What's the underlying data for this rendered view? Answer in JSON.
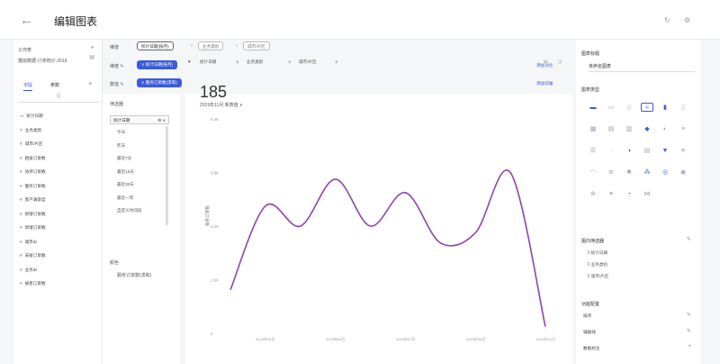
{
  "header": {
    "back_glyph": "←",
    "title": "编辑图表"
  },
  "left": {
    "worksheet_label": "工作表",
    "worksheet_name": "模拟数据-订单统计-2019",
    "tabs": [
      "字段",
      "参数"
    ],
    "search_glyph": "Q",
    "fields": [
      {
        "icon": "▭",
        "label": "统计日期"
      },
      {
        "icon": "T",
        "label": "业务类别"
      },
      {
        "icon": "T",
        "label": "城市/片区"
      },
      {
        "icon": "#",
        "label": "租投订单数"
      },
      {
        "icon": "#",
        "label": "协评订单数"
      },
      {
        "icon": "#",
        "label": "服务订单数"
      },
      {
        "icon": "#",
        "label": "客户满意度"
      },
      {
        "icon": "#",
        "label": "新增订单数"
      },
      {
        "icon": "#",
        "label": "新增订单数"
      },
      {
        "icon": "#",
        "label": "城市ID"
      },
      {
        "icon": "#",
        "label": "未接订单数"
      },
      {
        "icon": "#",
        "label": "业务ID"
      },
      {
        "icon": "#",
        "label": "被拒订单数"
      }
    ]
  },
  "toolbar": {
    "dimension_label": "维度",
    "dim_pills": [
      "统计日期(按月)",
      "业务类别",
      "城市/片区"
    ],
    "trend_label": "维度 ✎",
    "trend_pill": "∨ 统计日期(按月)",
    "add_compare": "添加对比",
    "value_label": "数值 ✎",
    "value_pill": "∨ 服务订单数(求和)",
    "add_axis": "添加双轴"
  },
  "filter": {
    "title": "筛选器",
    "dropdown": "统计日期",
    "options": [
      "今天",
      "昨天",
      "最近7天",
      "最近15天",
      "最近30天",
      "最近一年",
      "自定义时间段"
    ],
    "color_label": "颜色",
    "color_value": "服务订单数(求和)"
  },
  "chart_filters": [
    "统计日期",
    "业务类别",
    "城市/片区"
  ],
  "kpi": {
    "value": "185",
    "sub": "2019年11月 新数值 ∨"
  },
  "chart_data": {
    "type": "line",
    "x": [
      "2019年3月",
      "2019年4月",
      "2019年5月",
      "2019年6月",
      "2019年7月",
      "2019年8月",
      "2019年9月",
      "2019年10月",
      "2019年11月"
    ],
    "x_tick_labels": [
      "2019年05月",
      "2019年06月",
      "2019年07月",
      "2019年08月",
      "2019年11月"
    ],
    "y_tick_labels": [
      "0",
      "1.6K",
      "3.2K",
      "4.8K",
      "6.4K"
    ],
    "ylabel": "服务订单数",
    "series": [
      {
        "values": [
          1300,
          3800,
          3200,
          4600,
          3200,
          4200,
          2700,
          3000,
          4800,
          200
        ]
      }
    ],
    "ylim": [
      0,
      6400
    ],
    "color": "#8e44ad"
  },
  "right": {
    "title_section": "图表标题",
    "chart_title": "未命名图表",
    "type_section": "图表类型",
    "filter_section": "图内筛选器",
    "filter_items": [
      "统计日期",
      "业务类别",
      "城市/片区"
    ],
    "func_section": "功能配置",
    "func_items": [
      "排序",
      "辅助线",
      "数据标注"
    ]
  }
}
